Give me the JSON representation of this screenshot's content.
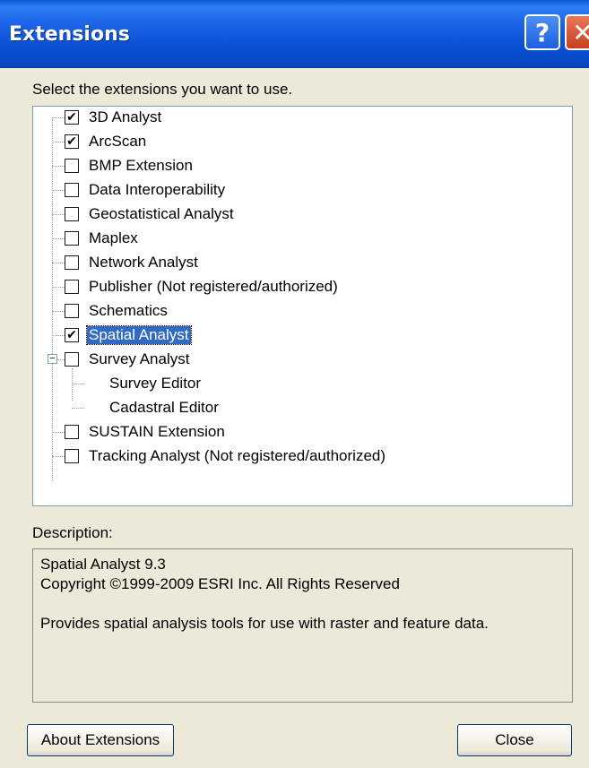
{
  "window": {
    "title": "Extensions",
    "help_label": "?",
    "close_label": "✕"
  },
  "instructions": "Select the extensions you want to use.",
  "extensions": [
    {
      "label": "3D Analyst",
      "checked": true,
      "mark": "✔"
    },
    {
      "label": "ArcScan",
      "checked": true,
      "mark": "✔"
    },
    {
      "label": "BMP Extension",
      "checked": false,
      "mark": ""
    },
    {
      "label": "Data Interoperability",
      "checked": false,
      "mark": ""
    },
    {
      "label": "Geostatistical Analyst",
      "checked": false,
      "mark": ""
    },
    {
      "label": "Maplex",
      "checked": false,
      "mark": ""
    },
    {
      "label": "Network Analyst",
      "checked": false,
      "mark": ""
    },
    {
      "label": "Publisher (Not registered/authorized)",
      "checked": false,
      "mark": ""
    },
    {
      "label": "Schematics",
      "checked": false,
      "mark": ""
    },
    {
      "label": "Spatial Analyst",
      "checked": true,
      "mark": "✔",
      "selected": true
    },
    {
      "label": "Survey Analyst",
      "checked": false,
      "mark": "",
      "expanded": true,
      "children": [
        "Survey Editor",
        "Cadastral Editor"
      ]
    },
    {
      "label": "SUSTAIN Extension",
      "checked": false,
      "mark": ""
    },
    {
      "label": "Tracking Analyst (Not registered/authorized)",
      "checked": false,
      "mark": ""
    }
  ],
  "expander_symbol": "−",
  "description": {
    "label": "Description:",
    "lines": [
      "Spatial Analyst 9.3",
      "Copyright ©1999-2009 ESRI Inc. All Rights Reserved",
      "",
      "Provides spatial analysis tools for use with raster and feature data."
    ]
  },
  "buttons": {
    "about_label": "About Extensions",
    "close_label": "Close"
  },
  "colors": {
    "titlebar": "#0b51d4",
    "selection": "#316ac5",
    "dialog_bg": "#ece9d8"
  }
}
